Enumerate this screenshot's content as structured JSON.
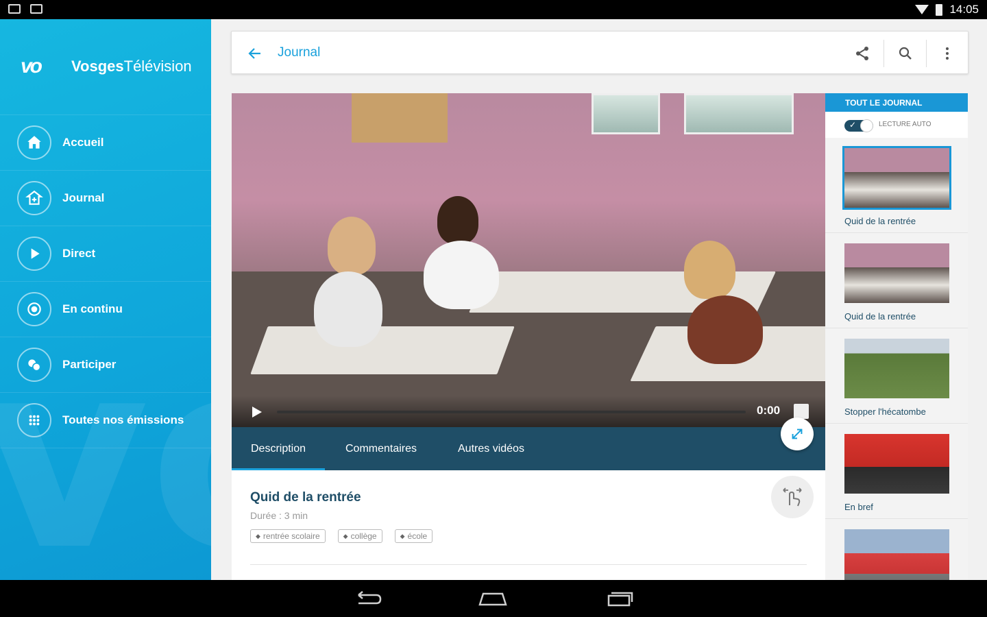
{
  "status_bar": {
    "time": "14:05"
  },
  "sidebar": {
    "brand_name_bold": "Vosges",
    "brand_name_light": "Télévision",
    "items": [
      {
        "label": "Accueil",
        "icon": "home-icon"
      },
      {
        "label": "Journal",
        "icon": "journal-icon"
      },
      {
        "label": "Direct",
        "icon": "play-icon"
      },
      {
        "label": "En continu",
        "icon": "continuous-icon"
      },
      {
        "label": "Participer",
        "icon": "participate-icon"
      },
      {
        "label": "Toutes nos émissions",
        "icon": "grid-icon"
      }
    ]
  },
  "topbar": {
    "title": "Journal"
  },
  "player": {
    "time": "0:00"
  },
  "tabs": [
    {
      "label": "Description",
      "active": true
    },
    {
      "label": "Commentaires",
      "active": false
    },
    {
      "label": "Autres vidéos",
      "active": false
    }
  ],
  "details": {
    "title": "Quid de la rentrée",
    "duration": "Durée : 3 min",
    "tags": [
      "rentrée scolaire",
      "collège",
      "école"
    ]
  },
  "playlist": {
    "header": "TOUT LE JOURNAL",
    "autoplay_label": "LECTURE AUTO",
    "autoplay_on": true,
    "items": [
      {
        "caption": "Quid de la rentrée",
        "active": true
      },
      {
        "caption": "Quid de la rentrée",
        "active": false
      },
      {
        "caption": "Stopper l'hécatombe",
        "active": false
      },
      {
        "caption": "En bref",
        "active": false
      },
      {
        "caption": "",
        "active": false
      }
    ]
  },
  "colors": {
    "accent": "#1aa1dc",
    "dark": "#1f4e67",
    "sidebar": "#13abdd"
  }
}
